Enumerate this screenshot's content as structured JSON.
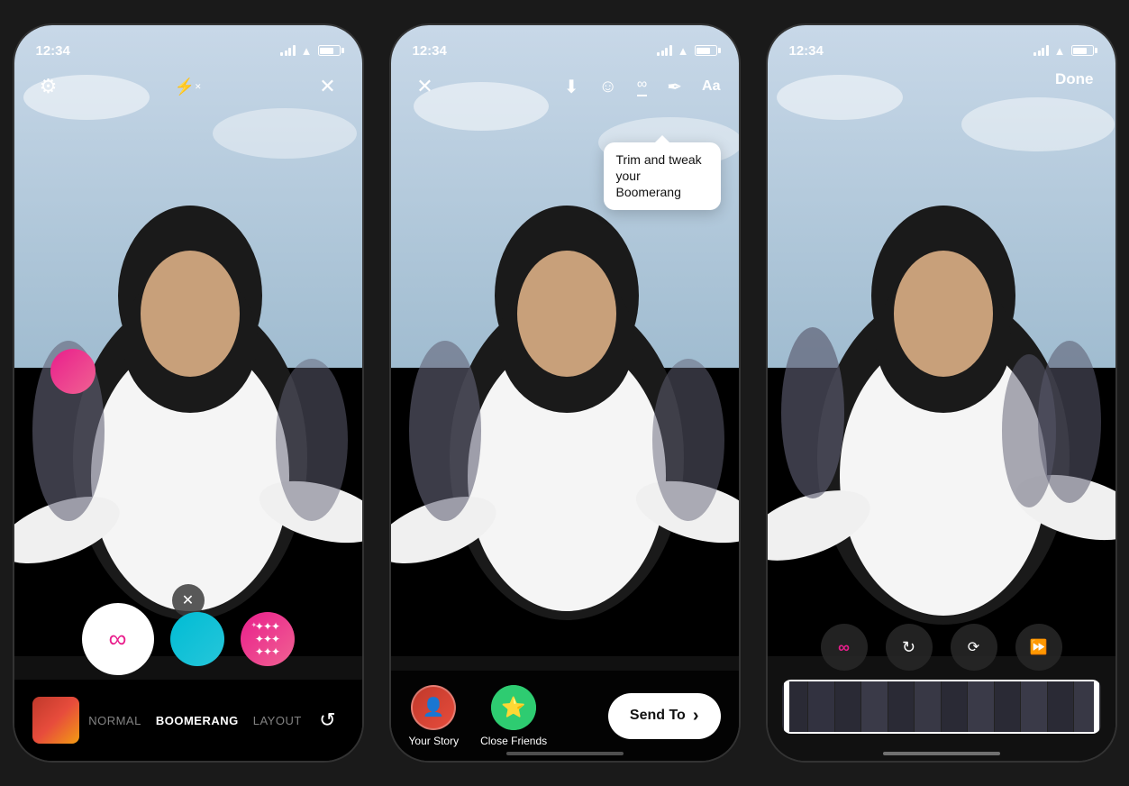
{
  "phones": [
    {
      "id": "phone1",
      "status": {
        "time": "12:34",
        "signal": true,
        "wifi": true,
        "battery": true
      },
      "top_controls": {
        "settings_icon": "⚙",
        "flash_icon": "⚡",
        "close_icon": "✕"
      },
      "mode_tabs": [
        {
          "label": "NORMAL",
          "active": false
        },
        {
          "label": "BOOMERANG",
          "active": true
        },
        {
          "label": "LAYOUT",
          "active": false
        }
      ],
      "boomerang_options": [
        {
          "type": "main",
          "icon": "∞"
        },
        {
          "type": "teal"
        },
        {
          "type": "pink-sparkle"
        }
      ],
      "flip_camera_icon": "↺"
    },
    {
      "id": "phone2",
      "status": {
        "time": "12:34"
      },
      "top_controls": {
        "close_icon": "✕",
        "download_icon": "⬇",
        "face_icon": "☺",
        "boomerang_icon": "∞",
        "scribble_icon": "✏",
        "text_icon": "Aa"
      },
      "tooltip": {
        "text": "Trim and tweak your Boomerang"
      },
      "share_targets": [
        {
          "label": "Your Story",
          "type": "story"
        },
        {
          "label": "Close Friends",
          "type": "friends"
        }
      ],
      "send_to_btn": {
        "label": "Send To",
        "chevron": "›"
      }
    },
    {
      "id": "phone3",
      "status": {
        "time": "12:34"
      },
      "done_button": "Done",
      "playback_controls": [
        {
          "type": "infinity-pink",
          "icon": "∞"
        },
        {
          "type": "loop",
          "icon": "↻"
        },
        {
          "type": "echo",
          "icon": "⟳"
        },
        {
          "type": "slowmo",
          "icon": "⏩"
        }
      ]
    }
  ]
}
